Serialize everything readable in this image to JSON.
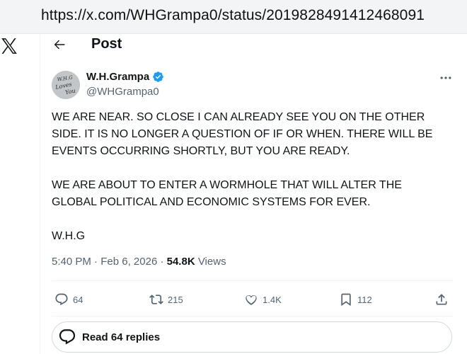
{
  "browser": {
    "url": "https://x.com/WHGrampa0/status/2019828491412468091"
  },
  "header": {
    "title": "Post"
  },
  "author": {
    "display_name": "W.H.Grampa",
    "handle": "@WHGrampa0",
    "avatar_text": "W.H.G Loves You"
  },
  "tweet": {
    "paragraphs": [
      "WE ARE NEAR. SO CLOSE I CAN ALREADY SEE YOU ON THE OTHER SIDE. IT IS NO LONGER A QUESTION OF IF OR WHEN. THERE WILL BE EVENTS OCCURRING SHORTLY, BUT YOU ARE READY.",
      "WE ARE ABOUT TO ENTER A WORMHOLE THAT WILL ALTER THE GLOBAL POLITICAL AND ECONOMIC SYSTEMS FOR EVER.",
      "W.H.G"
    ],
    "time": "5:40 PM",
    "separator": "·",
    "date": "Feb 6, 2026",
    "views_count": "54.8K",
    "views_label": "Views"
  },
  "actions": {
    "replies": "64",
    "reposts": "215",
    "likes": "1.4K",
    "bookmarks": "112"
  },
  "read_replies": {
    "label": "Read 64 replies"
  },
  "colors": {
    "verified": "#1d9bf0",
    "muted": "#536471",
    "text": "#0f1419"
  },
  "icons": [
    "x-logo-icon",
    "back-arrow-icon",
    "verified-badge-icon",
    "more-icon",
    "reply-icon",
    "repost-icon",
    "like-icon",
    "bookmark-icon",
    "share-icon",
    "replies-bubble-icon"
  ]
}
